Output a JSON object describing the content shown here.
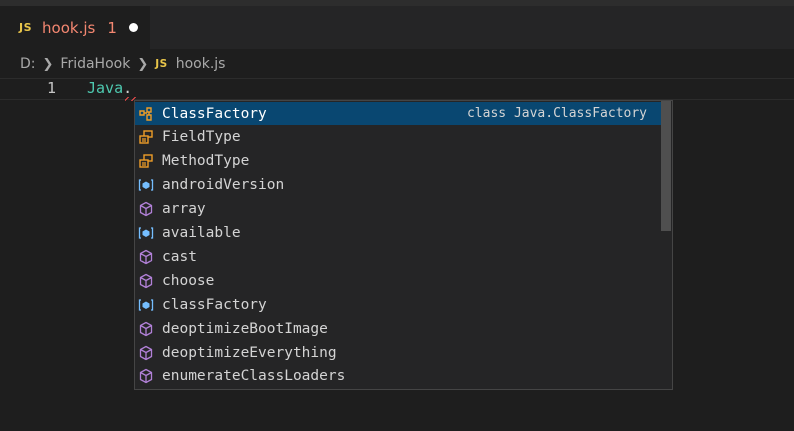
{
  "tab": {
    "badge": "JS",
    "filename": "hook.js",
    "problem_count": "1"
  },
  "breadcrumb": {
    "drive": "D:",
    "folder": "FridaHook",
    "file_badge": "JS",
    "file": "hook.js"
  },
  "editor": {
    "line_number": "1",
    "identifier": "Java",
    "punctuation": "."
  },
  "suggest": {
    "selected_detail": "class Java.ClassFactory",
    "items": [
      {
        "label": "ClassFactory",
        "icon": "class-icon"
      },
      {
        "label": "FieldType",
        "icon": "enum-icon"
      },
      {
        "label": "MethodType",
        "icon": "enum-icon"
      },
      {
        "label": "androidVersion",
        "icon": "variable-icon"
      },
      {
        "label": "array",
        "icon": "method-icon"
      },
      {
        "label": "available",
        "icon": "variable-icon"
      },
      {
        "label": "cast",
        "icon": "method-icon"
      },
      {
        "label": "choose",
        "icon": "method-icon"
      },
      {
        "label": "classFactory",
        "icon": "variable-icon"
      },
      {
        "label": "deoptimizeBootImage",
        "icon": "method-icon"
      },
      {
        "label": "deoptimizeEverything",
        "icon": "method-icon"
      },
      {
        "label": "enumerateClassLoaders",
        "icon": "method-icon"
      }
    ]
  },
  "colors": {
    "selected_row": "#094771",
    "enum": "#ee9d28",
    "variable": "#75beff",
    "method": "#b180d7",
    "error": "#f48771"
  }
}
